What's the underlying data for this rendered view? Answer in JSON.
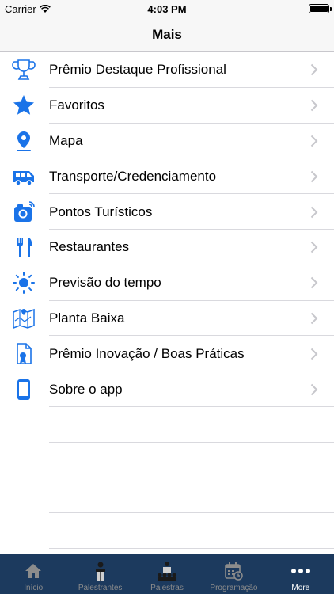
{
  "status_bar": {
    "carrier": "Carrier",
    "time": "4:03 PM"
  },
  "nav": {
    "title": "Mais"
  },
  "menu": {
    "items": [
      {
        "label": "Prêmio Destaque Profissional",
        "icon": "trophy-icon"
      },
      {
        "label": "Favoritos",
        "icon": "star-icon"
      },
      {
        "label": "Mapa",
        "icon": "map-pin-icon"
      },
      {
        "label": "Transporte/Credenciamento",
        "icon": "bus-icon"
      },
      {
        "label": "Pontos Turísticos",
        "icon": "camera-icon"
      },
      {
        "label": "Restaurantes",
        "icon": "cutlery-icon"
      },
      {
        "label": "Previsão do tempo",
        "icon": "sun-icon"
      },
      {
        "label": "Planta Baixa",
        "icon": "floor-plan-icon"
      },
      {
        "label": "Prêmio Inovação / Boas Práticas",
        "icon": "award-document-icon"
      },
      {
        "label": "Sobre o app",
        "icon": "phone-icon"
      }
    ]
  },
  "tabs": [
    {
      "label": "Início",
      "icon": "home-icon",
      "active": false
    },
    {
      "label": "Palestrantes",
      "icon": "speaker-icon",
      "active": false
    },
    {
      "label": "Palestras",
      "icon": "lecture-icon",
      "active": false
    },
    {
      "label": "Programação",
      "icon": "calendar-icon",
      "active": false
    },
    {
      "label": "More",
      "icon": "more-dots-icon",
      "active": true
    }
  ],
  "colors": {
    "accent": "#1a73e8",
    "tab_bar": "#1c3a5e"
  }
}
